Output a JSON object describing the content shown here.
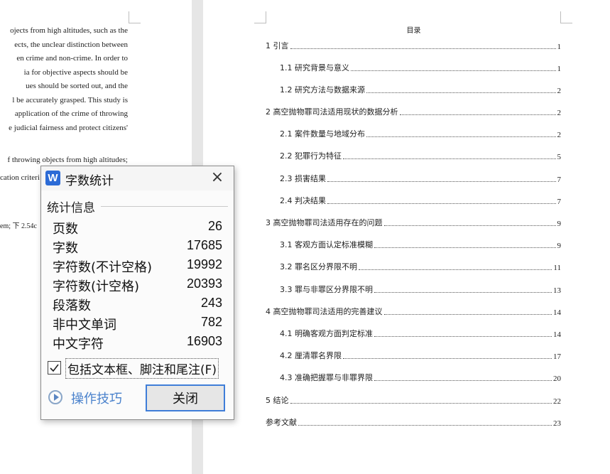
{
  "left_page": {
    "lines": [
      "ojects from high altitudes, such as the",
      "ects, the unclear distinction between",
      "en crime and non-crime. In order to",
      "ia for objective aspects should be",
      "ues should be sorted out, and the",
      "l be accurately grasped. This study is",
      "application of the crime of throwing",
      "e judicial fairness and protect citizens'",
      "f throwing objects from high altitudes;",
      "cation criteri",
      "em; 下 2.54c"
    ]
  },
  "toc": {
    "title": "目录",
    "entries": [
      {
        "label": "1  引言",
        "page": "1",
        "level": 1
      },
      {
        "label": "1.1  研究背景与意义",
        "page": "1",
        "level": 2
      },
      {
        "label": "1.2  研究方法与数据来源",
        "page": "2",
        "level": 2
      },
      {
        "label": "2  高空抛物罪司法适用现状的数据分析",
        "page": "2",
        "level": 1
      },
      {
        "label": "2.1  案件数量与地域分布",
        "page": "2",
        "level": 2
      },
      {
        "label": "2.2  犯罪行为特征",
        "page": "5",
        "level": 2
      },
      {
        "label": "2.3  损害结果",
        "page": "7",
        "level": 2
      },
      {
        "label": "2.4  判决结果",
        "page": "7",
        "level": 2
      },
      {
        "label": "3  高空抛物罪司法适用存在的问题",
        "page": "9",
        "level": 1
      },
      {
        "label": "3.1  客观方面认定标准模糊",
        "page": "9",
        "level": 2
      },
      {
        "label": "3.2  罪名区分界限不明",
        "page": "11",
        "level": 2
      },
      {
        "label": "3.3  罪与非罪区分界限不明",
        "page": "13",
        "level": 2
      },
      {
        "label": "4  高空抛物罪司法适用的完善建议",
        "page": "14",
        "level": 1
      },
      {
        "label": "4.1  明确客观方面判定标准",
        "page": "14",
        "level": 2
      },
      {
        "label": "4.2  厘清罪名界限",
        "page": "17",
        "level": 2
      },
      {
        "label": "4.3  准确把握罪与非罪界限",
        "page": "20",
        "level": 2
      },
      {
        "label": "5  结论",
        "page": "22",
        "level": 1
      },
      {
        "label": "参考文献",
        "page": "23",
        "level": 1
      }
    ]
  },
  "dialog": {
    "logo": "W",
    "title": "字数统计",
    "close_icon": "×",
    "section_label": "统计信息",
    "stats": [
      {
        "label": "页数",
        "value": "26"
      },
      {
        "label": "字数",
        "value": "17685"
      },
      {
        "label": "字符数(不计空格)",
        "value": "19992"
      },
      {
        "label": "字符数(计空格)",
        "value": "20393"
      },
      {
        "label": "段落数",
        "value": "243"
      },
      {
        "label": "非中文单词",
        "value": "782"
      },
      {
        "label": "中文字符",
        "value": "16903"
      }
    ],
    "checkbox_label": "包括文本框、脚注和尾注(F)",
    "checkbox_checked": true,
    "tips_label": "操作技巧",
    "close_button": "关闭"
  }
}
